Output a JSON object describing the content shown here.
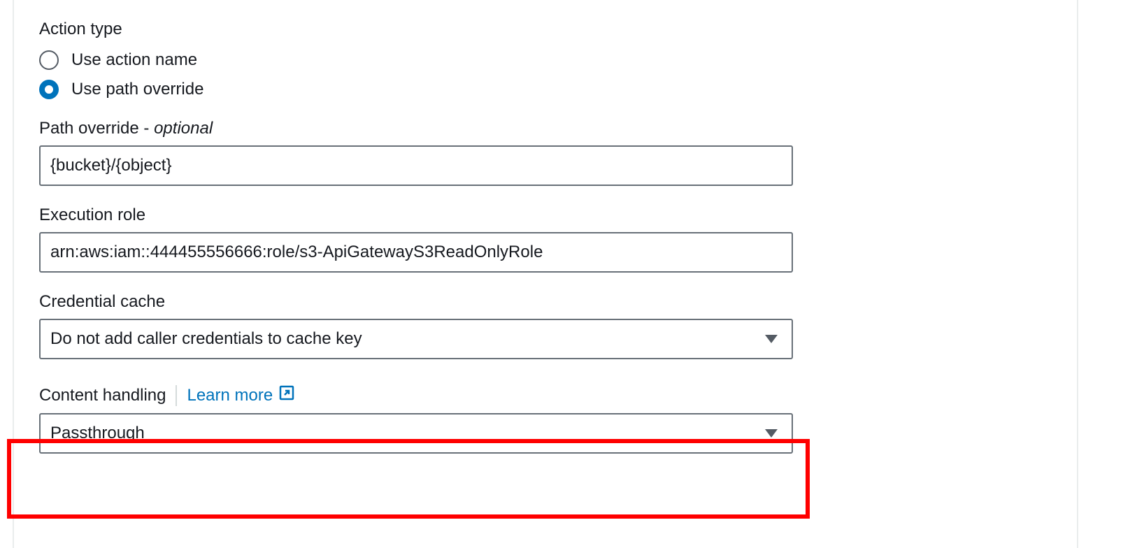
{
  "action_type": {
    "label": "Action type",
    "options": [
      {
        "label": "Use action name",
        "selected": false
      },
      {
        "label": "Use path override",
        "selected": true
      }
    ]
  },
  "path_override": {
    "label": "Path override - ",
    "optional_text": "optional",
    "value": "{bucket}/{object}"
  },
  "execution_role": {
    "label": "Execution role",
    "value": "arn:aws:iam::444455556666:role/s3-ApiGatewayS3ReadOnlyRole"
  },
  "credential_cache": {
    "label": "Credential cache",
    "value": "Do not add caller credentials to cache key"
  },
  "content_handling": {
    "label": "Content handling",
    "learn_more": "Learn more",
    "value": "Passthrough"
  }
}
